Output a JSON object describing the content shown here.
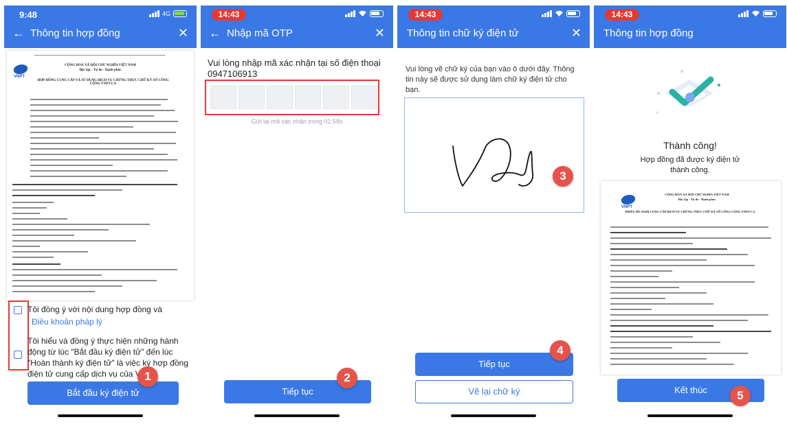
{
  "screens": [
    {
      "status_time": "9:48",
      "network": "4G",
      "header_title": "Thông tin hợp đồng",
      "doc": {
        "national_title": "CỘNG HOÀ XÃ HỘI CHỦ NGHĨA VIỆT NAM",
        "motto": "Độc lập - Tự do - Hạnh phúc",
        "contract_title": "HỢP ĐỒNG CUNG CẤP VÀ SỬ DỤNG DỊCH VỤ CHỨNG THỰC CHỮ KÝ SỐ CÔNG CỘNG VNPT-CA",
        "logo_text": "VNPT"
      },
      "agree1_text": "Tôi đồng ý với nội dung hợp đồng và",
      "agree1_link": "Điều khoản pháp lý",
      "agree2_text": "Tôi hiểu và đồng ý thực hiện những hành động từ lúc \"Bắt đầu ký điện tử\" đến lúc \"Hoàn thành ký điện tử\" là việc ký hợp đồng điện tử cung cấp dịch vụ của VNPT",
      "button": "Bắt đầu ký điện tử",
      "step": "1"
    },
    {
      "status_time": "14:43",
      "header_title": "Nhập mã OTP",
      "prompt": "Vui lòng nhập mã xác nhận tại số điện thoại 0947106913",
      "otp_boxes": 6,
      "resend": "Gửi lại mã xác nhận trong 01:58s",
      "button": "Tiếp tục",
      "step": "2"
    },
    {
      "status_time": "14:43",
      "header_title": "Thông tin chữ ký điện tử",
      "instruction": "Vui lòng vẽ chữ ký của bạn vào ô dưới đây. Thông tin này sẽ được sử dụng làm chữ ký điện tử cho bạn.",
      "button_primary": "Tiếp tục",
      "button_secondary": "Vẽ lại chữ ký",
      "step_sign": "3",
      "step": "4"
    },
    {
      "status_time": "14:43",
      "header_title": "Thông tin hợp đồng",
      "success_title": "Thành công!",
      "success_text": "Hợp đồng đã được ký điện tử thành công.",
      "doc": {
        "national_title": "CỘNG HOÀ XÃ HỘI CHỦ NGHĨA VIỆT NAM",
        "motto": "Độc lập - Tự do - Hạnh phúc",
        "contract_title": "PHIẾU ĐỀ NGHỊ CUNG CẤP DỊCH VỤ CHỨNG THỰC CHỮ KÝ SỐ CÔNG CỘNG VNPT-CA",
        "logo_text": "VNPT"
      },
      "button": "Kết thúc",
      "step": "5"
    }
  ],
  "colors": {
    "header": "#3a78e6",
    "button": "#3a78e6",
    "badge": "#e5534b",
    "highlight": "#e53935",
    "success_check": "#2bb3a3"
  }
}
